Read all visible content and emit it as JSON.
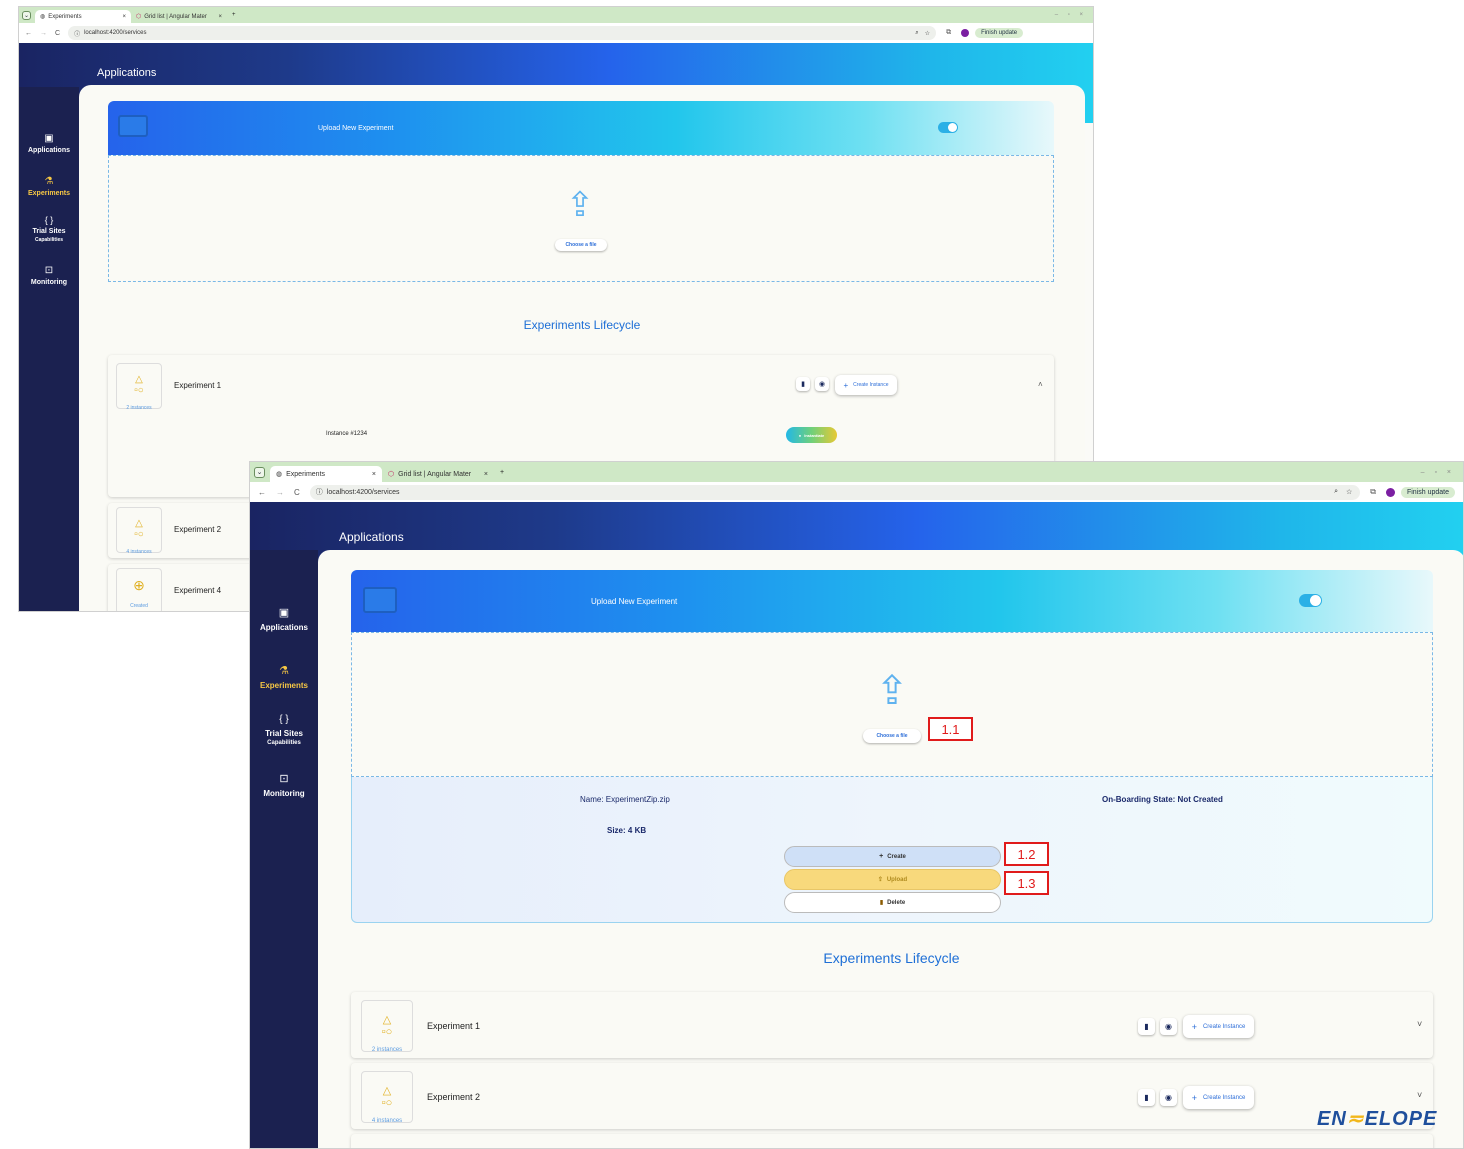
{
  "browser": {
    "tab_active": "Experiments",
    "tab_other": "Grid list | Angular Mater",
    "tab_close": "×",
    "new_tab": "+",
    "url": "localhost:4200/services",
    "finish_update": "Finish update",
    "window_controls": "– ▫ ×",
    "tab_menu": "⌄"
  },
  "page": {
    "header_title": "Applications",
    "sidebar": [
      {
        "label": "Applications",
        "sub": "",
        "icon": "app-window-icon",
        "active": false
      },
      {
        "label": "Experiments",
        "sub": "",
        "icon": "flask-icon",
        "active": true
      },
      {
        "label": "Trial Sites",
        "sub": "Capabilities",
        "icon": "braces-icon",
        "active": false
      },
      {
        "label": "Monitoring",
        "sub": "",
        "icon": "monitor-chart-icon",
        "active": false
      }
    ],
    "upload": {
      "title": "Upload New Experiment",
      "choose": "Choose a file"
    },
    "lifecycle_title": "Experiments Lifecycle",
    "create_instance": "Create Instance"
  },
  "shot1": {
    "experiments": [
      {
        "name": "Experiment 1",
        "status": "2 instances",
        "icon": "shapes-icon"
      },
      {
        "name": "Experiment 2",
        "status": "4 instances",
        "icon": "shapes-icon"
      },
      {
        "name": "Experiment 4",
        "status": "Created",
        "icon": "plus-circle-icon"
      }
    ],
    "instance_label": "Instance #1234",
    "instantiate": "Instantiate"
  },
  "shot2": {
    "file": {
      "name": "Name: ExperimentZip.zip",
      "state": "On-Boarding State: Not Created",
      "size": "Size: 4 KB"
    },
    "actions": {
      "create": "Create",
      "upload": "Upload",
      "delete": "Delete"
    },
    "annotations": {
      "choose": "1.1",
      "create": "1.2",
      "upload": "1.3"
    },
    "experiments": [
      {
        "name": "Experiment 1",
        "status": "2 instances"
      },
      {
        "name": "Experiment 2",
        "status": "4 instances"
      }
    ]
  },
  "logo": {
    "left": "EN",
    "right": "ELOPE"
  },
  "colors": {
    "sidebar": "#1b2150",
    "accent": "#f6c744",
    "link": "#1e6fd6",
    "annotation": "#e01b1b"
  }
}
